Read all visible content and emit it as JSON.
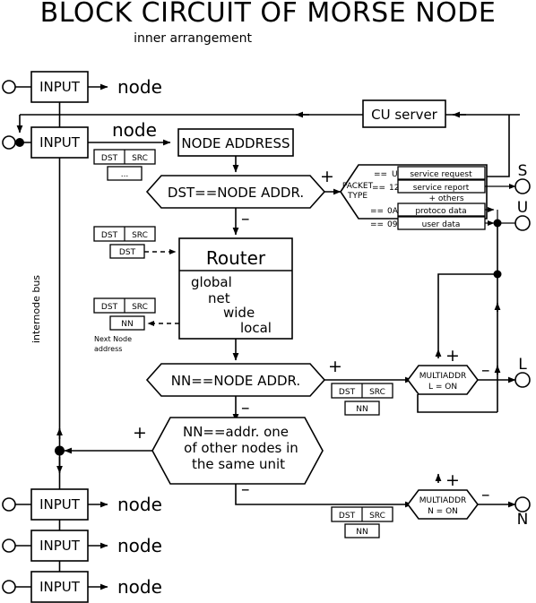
{
  "title": "BLOCK CIRCUIT OF MORSE NODE",
  "subtitle": "inner arrangement",
  "labels": {
    "node": "node",
    "dst": "DST",
    "src": "SRC",
    "dots": "...",
    "nn": "NN",
    "input": "INPUT",
    "plus": "+",
    "minus": "–",
    "internode_bus": "internode bus",
    "next_node_1": "Next Node",
    "next_node_2": "address"
  },
  "blocks": {
    "input_top": "INPUT",
    "input_second": "INPUT",
    "input_b1": "INPUT",
    "input_b2": "INPUT",
    "input_b3": "INPUT",
    "node_address": "NODE ADDRESS",
    "cu_server": "CU server",
    "router_title": "Router",
    "router_modes": [
      "global",
      "net",
      "wide",
      "local"
    ],
    "dst_eq_node": "DST==NODE ADDR.",
    "nn_eq_node": "NN==NODE ADDR.",
    "nn_other_line1": "NN==addr. one",
    "nn_other_line2": "of other nodes in",
    "nn_other_line3": "the same unit",
    "multiaddr_l_line1": "MULTIADDR",
    "multiaddr_l_line2": "L = ON",
    "multiaddr_n_line1": "MULTIADDR",
    "multiaddr_n_line2": "N = ON"
  },
  "packet_type": {
    "label_line1": "PACKET",
    "label_line2": "TYPE",
    "rows": [
      {
        "op": "==",
        "code": "U",
        "text": "service request",
        "text2": ""
      },
      {
        "op": "==",
        "code": "12",
        "text": "service report",
        "text2": "+ others"
      },
      {
        "op": "==",
        "code": "0A",
        "text": "protoco data",
        "text2": ""
      },
      {
        "op": "==",
        "code": "09",
        "text": "user data",
        "text2": ""
      }
    ]
  },
  "terminals": [
    {
      "name": "S"
    },
    {
      "name": "U"
    },
    {
      "name": "L"
    },
    {
      "name": "N"
    }
  ],
  "colors": {
    "line": "#000000",
    "fill": "#ffffff",
    "text": "#000000"
  }
}
